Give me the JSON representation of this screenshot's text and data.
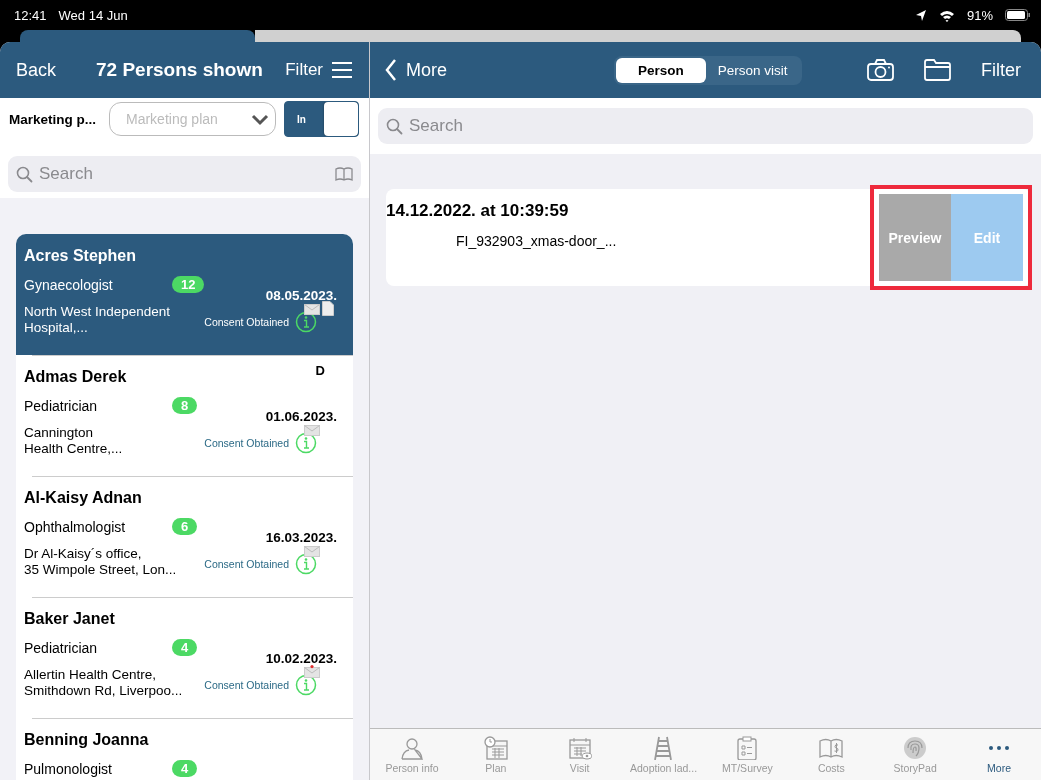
{
  "status_bar": {
    "time": "12:41",
    "date": "Wed 14 Jun",
    "battery": "91%"
  },
  "left_header": {
    "back": "Back",
    "title": "72 Persons shown",
    "filter": "Filter"
  },
  "filter_row": {
    "label": "Marketing p...",
    "dropdown_placeholder": "Marketing plan",
    "toggle_label": "In",
    "toggle_on": true
  },
  "left_search": {
    "placeholder": "Search"
  },
  "persons": [
    {
      "name": "Acres Stephen",
      "specialty": "Gynaecologist",
      "count": "12",
      "date": "08.05.2023.",
      "address": [
        "North West Independent",
        "Hospital,..."
      ],
      "consent": "Consent Obtained",
      "selected": true,
      "mail_alert": false,
      "has_document": true
    },
    {
      "name": "Admas Derek",
      "corner_text": "D",
      "specialty": "Pediatrician",
      "count": "8",
      "date": "01.06.2023.",
      "address": [
        "Cannington",
        "Health Centre,..."
      ],
      "consent": "Consent Obtained",
      "selected": false,
      "mail_alert": false,
      "has_document": false
    },
    {
      "name": "Al-Kaisy Adnan",
      "specialty": "Ophthalmologist",
      "count": "6",
      "date": "16.03.2023.",
      "address": [
        "Dr Al-Kaisy´s office,",
        "35 Wimpole Street, Lon..."
      ],
      "consent": "Consent Obtained",
      "selected": false,
      "mail_alert": false,
      "has_document": false
    },
    {
      "name": "Baker Janet",
      "specialty": "Pediatrician",
      "count": "4",
      "date": "10.02.2023.",
      "address": [
        "Allertin Health Centre,",
        "Smithdown Rd, Liverpoo..."
      ],
      "consent": "Consent Obtained",
      "selected": false,
      "mail_alert": true,
      "has_document": false
    },
    {
      "name": "Benning Joanna",
      "specialty": "Pulmonologist",
      "count": "4",
      "selected": false
    }
  ],
  "right_header": {
    "back": "More",
    "segments": [
      {
        "label": "Person",
        "selected": true
      },
      {
        "label": "Person visit",
        "selected": false
      }
    ],
    "filter": "Filter"
  },
  "right_search": {
    "placeholder": "Search"
  },
  "document": {
    "title": "14.12.2022. at 10:39:59",
    "file": "FI_932903_xmas-door_...",
    "actions": [
      {
        "label": "Preview",
        "kind": "preview"
      },
      {
        "label": "Edit",
        "kind": "edit"
      }
    ],
    "highlighted": true
  },
  "tab_bar": [
    {
      "label": "Person info",
      "kind": "person",
      "selected": false
    },
    {
      "label": "Plan",
      "kind": "plan",
      "selected": false
    },
    {
      "label": "Visit",
      "kind": "visit",
      "selected": false
    },
    {
      "label": "Adoption lad...",
      "kind": "ladder",
      "selected": false
    },
    {
      "label": "MT/Survey",
      "kind": "survey",
      "selected": false
    },
    {
      "label": "Costs",
      "kind": "costs",
      "selected": false
    },
    {
      "label": "StoryPad",
      "kind": "fingerprint",
      "selected": false
    },
    {
      "label": "More",
      "kind": "dots",
      "selected": true
    }
  ]
}
